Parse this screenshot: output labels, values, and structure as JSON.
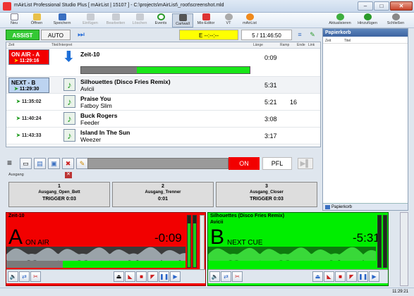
{
  "window": {
    "title": "mAirList Professional Studio Plus [ mAirList | 15107 ] - C:\\projects\\mAirList\\_root\\screenshot.mld",
    "minimize": "–",
    "maximize": "□",
    "close": "✕"
  },
  "ribbon": {
    "left": [
      {
        "label": "Neu",
        "icon": "document-new-icon",
        "enabled": true
      },
      {
        "label": "Öffnen",
        "icon": "folder-open-icon",
        "enabled": true
      },
      {
        "label": "Speichern",
        "icon": "save-icon",
        "enabled": true
      },
      {
        "label": "Einfügen",
        "icon": "paste-icon",
        "enabled": false
      },
      {
        "label": "Bearbeiten",
        "icon": "edit-icon",
        "enabled": false
      },
      {
        "label": "Löschen",
        "icon": "delete-icon",
        "enabled": false
      },
      {
        "label": "Events",
        "icon": "events-icon",
        "enabled": true
      },
      {
        "label": "Cartwall",
        "icon": "cartwall-icon",
        "enabled": true,
        "pressed": true
      },
      {
        "label": "Mix-Editor",
        "icon": "mix-editor-icon",
        "enabled": true
      },
      {
        "label": "VT",
        "icon": "voicetrack-icon",
        "enabled": true
      },
      {
        "label": "mAirList",
        "icon": "mairlist-logo-icon",
        "enabled": true
      }
    ],
    "right": [
      {
        "label": "Aktualisieren",
        "icon": "refresh-icon"
      },
      {
        "label": "Hinzufügen",
        "icon": "add-icon"
      },
      {
        "label": "Schließen",
        "icon": "close-icon"
      }
    ]
  },
  "modebar": {
    "assist": "ASSIST",
    "auto": "AUTO",
    "skip": "⏭",
    "event_timer": "E  --:--:--",
    "clock": "5 / 11:46:50",
    "list_icon": "≡",
    "edit_icon": "✎"
  },
  "playlist": {
    "headers": {
      "time": "Zeit",
      "title": "Titel/Interpret",
      "length": "Länge",
      "ramp": "Ramp",
      "end": "Ende",
      "link": "Link"
    },
    "onair": {
      "slot": "ON AIR - A",
      "time": "11:29:16",
      "title": "Zeit-10",
      "length": "0:09",
      "progress": 0.67
    },
    "next": {
      "slot": "NEXT - B",
      "time": "11:29:30",
      "title": "Silhouettes (Disco Fries Remix)",
      "artist": "Avicii",
      "length": "5:31"
    },
    "rows": [
      {
        "time": "11:35:02",
        "title": "Praise You",
        "artist": "Fatboy Slim",
        "length": "5:21",
        "ramp": "16"
      },
      {
        "time": "11:40:24",
        "title": "Buck Rogers",
        "artist": "Feeder",
        "length": "3:08",
        "ramp": ""
      },
      {
        "time": "11:43:33",
        "title": "Island In The Sun",
        "artist": "Weezer",
        "length": "3:17",
        "ramp": ""
      }
    ]
  },
  "controls": {
    "on": "ON",
    "pfl": "PFL",
    "next": "▶▌"
  },
  "ausgang": {
    "label": "Ausgang",
    "close": "✕",
    "triggers": [
      {
        "num": "1",
        "name": "Ausgang_Open_Bett",
        "value": "TRIGGER 0:03"
      },
      {
        "num": "2",
        "name": "Ausgang_Trenner",
        "value": "0:01"
      },
      {
        "num": "3",
        "name": "Ausgang_Closer",
        "value": "TRIGGER 0:03"
      }
    ]
  },
  "papierkorb": {
    "title": "Papierkorb",
    "col_time": "Zeit",
    "col_title": "Titel",
    "footer": "Papierkorb"
  },
  "playerA": {
    "title": "Zeit-10",
    "letter": "A",
    "status": "ON AIR",
    "time": "-0:09",
    "level": 0.85
  },
  "playerB": {
    "title": "Silhouettes (Disco Fries Remix)",
    "artist": "Avicii",
    "letter": "B",
    "status": "NEXT CUE",
    "time": "-5:31",
    "level": 0
  },
  "statusbar": {
    "time": "11:29:21"
  },
  "colors": {
    "onair": "#f20000",
    "next": "#00ee00",
    "assist": "#34c934",
    "event": "#ffff00"
  }
}
